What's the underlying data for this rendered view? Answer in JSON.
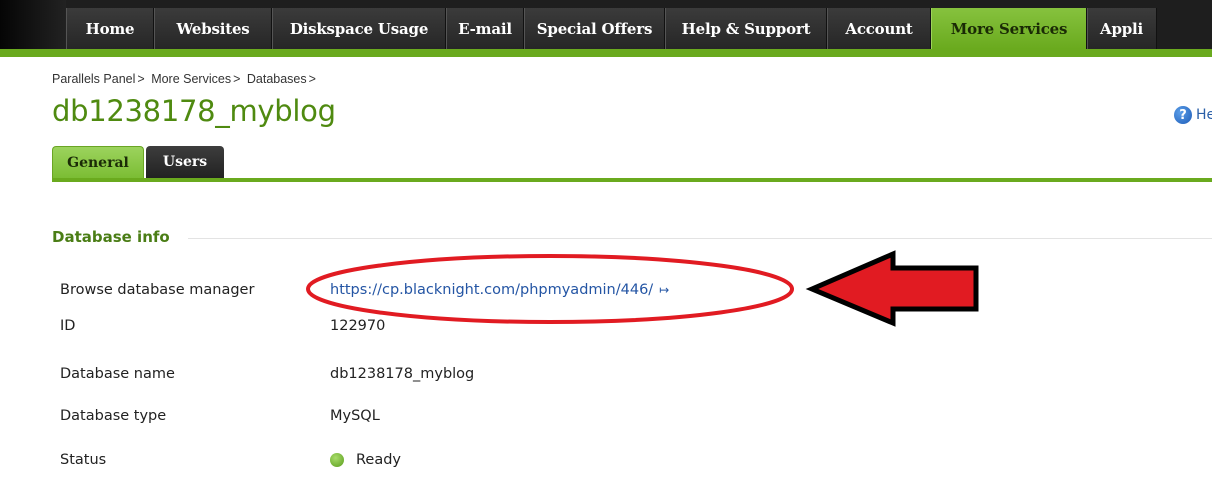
{
  "topnav": {
    "tabs": [
      {
        "label": "Home",
        "active": false
      },
      {
        "label": "Websites",
        "active": false
      },
      {
        "label": "Diskspace Usage",
        "active": false
      },
      {
        "label": "E-mail",
        "active": false
      },
      {
        "label": "Special Offers",
        "active": false
      },
      {
        "label": "Help & Support",
        "active": false
      },
      {
        "label": "Account",
        "active": false
      },
      {
        "label": "More Services",
        "active": true
      },
      {
        "label": "Appli",
        "active": false
      }
    ]
  },
  "breadcrumb": {
    "items": [
      "Parallels Panel",
      "More Services",
      "Databases"
    ],
    "separator": ">"
  },
  "page": {
    "title": "db1238178_myblog",
    "help_label": "Help",
    "help_icon": "question-circle-icon"
  },
  "subtabs": [
    {
      "label": "General",
      "active": true
    },
    {
      "label": "Users",
      "active": false
    }
  ],
  "section": {
    "title": "Database info",
    "rows": [
      {
        "label": "Browse database manager",
        "value": "https://cp.blacknight.com/phpmyadmin/446/",
        "is_link": true
      },
      {
        "label": "ID",
        "value": "122970"
      },
      {
        "label": "Database name",
        "value": "db1238178_myblog"
      },
      {
        "label": "Database type",
        "value": "MySQL"
      },
      {
        "label": "Status",
        "value": "Ready"
      }
    ]
  },
  "colors": {
    "accent_green": "#6aaa1e",
    "title_green": "#4f8a10",
    "link_blue": "#2455a4",
    "annotation_red": "#e11b22"
  }
}
